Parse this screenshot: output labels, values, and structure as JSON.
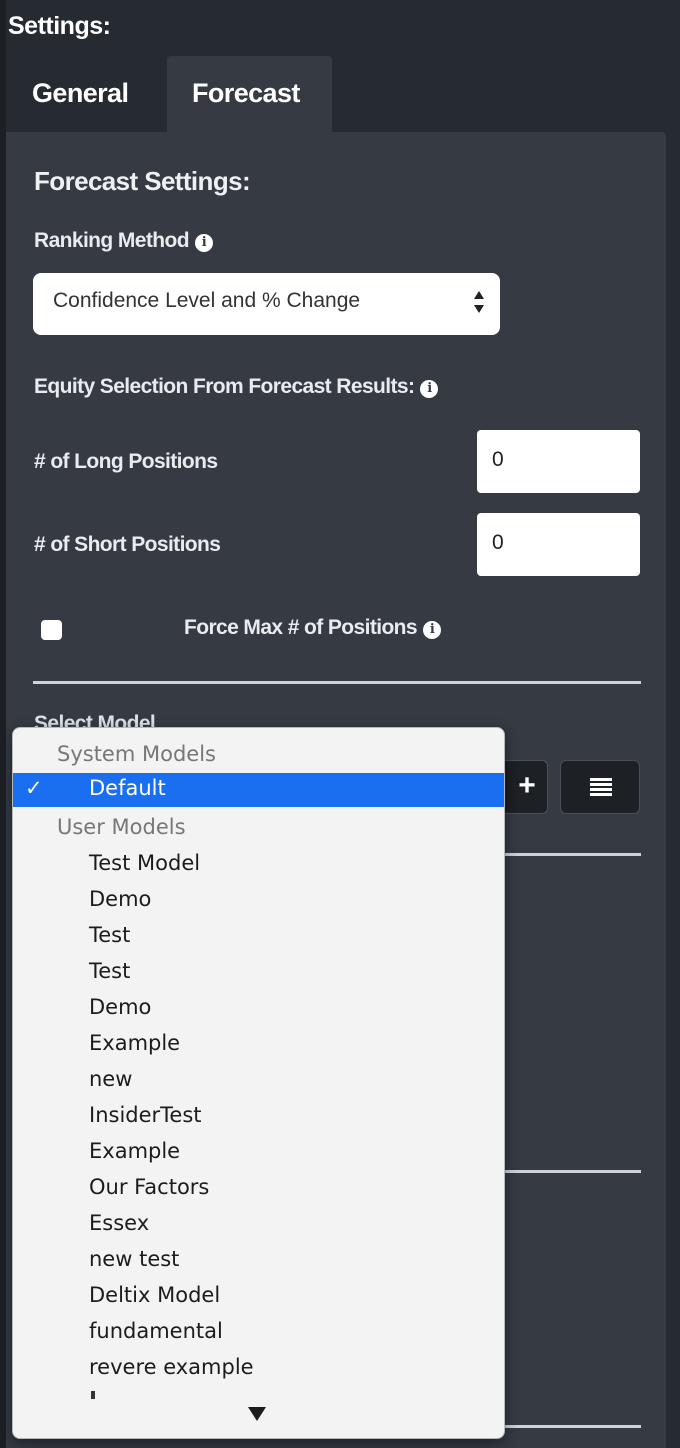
{
  "header": {
    "title": "Settings:"
  },
  "tabs": [
    {
      "label": "General"
    },
    {
      "label": "Forecast"
    }
  ],
  "forecast": {
    "heading": "Forecast Settings:",
    "ranking_method_label": "Ranking Method",
    "ranking_method_value": "Confidence Level and % Change",
    "equity_selection_label": "Equity Selection From Forecast Results:",
    "long_positions_label": "# of Long Positions",
    "long_positions_value": "0",
    "short_positions_label": "# of Short Positions",
    "short_positions_value": "0",
    "force_max_label": "Force Max # of Positions",
    "force_max_checked": false,
    "select_model_label": "Select Model",
    "add_button_glyph": "+",
    "list_button_icon": "list-icon"
  },
  "model_dropdown": {
    "groups": [
      {
        "label": "System Models",
        "options": [
          "Default"
        ]
      },
      {
        "label": "User Models",
        "options": [
          "Test Model",
          "Demo",
          "Test",
          "Test",
          "Demo",
          "Example",
          "new",
          "InsiderTest",
          "Example",
          "Our Factors",
          "Essex",
          "new test",
          "Deltix Model",
          "fundamental",
          "revere example"
        ]
      }
    ],
    "selected": "Default",
    "check_glyph": "✓"
  },
  "colors": {
    "background": "#262a31",
    "panel": "#353a43",
    "selection": "#1a6ff0"
  }
}
